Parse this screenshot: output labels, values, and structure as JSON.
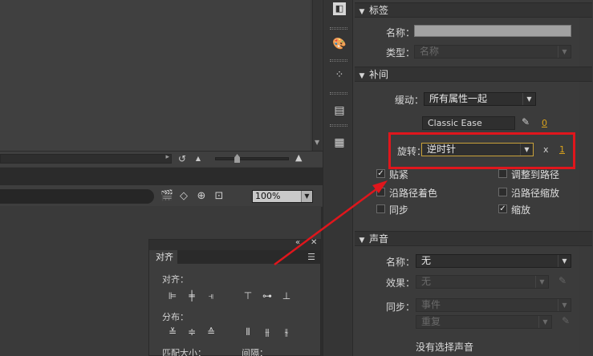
{
  "stage": {
    "timeline_icons": [
      "↺",
      "▲",
      "▲"
    ],
    "toolbar_icons": [
      "🎬",
      "◇",
      "⊕",
      "⊡"
    ],
    "zoom_value": "100%",
    "zoom_slider_level": 0.3
  },
  "align_panel": {
    "tab": "对齐",
    "align_label": "对齐：",
    "distribute_label": "分布：",
    "match_size_label": "匹配大小：",
    "spacing_label": "间隔："
  },
  "tweens_panel": {
    "label_section": {
      "title": "标签",
      "name_label": "名称：",
      "name_value": "",
      "type_label": "类型：",
      "type_value": "名称"
    },
    "tween_section": {
      "title": "补间",
      "ease_label": "缓动：",
      "ease_value": "所有属性一起",
      "ease_preset": "Classic Ease",
      "ease_number": "0",
      "rotate_label": "旋转：",
      "rotate_value": "逆时针",
      "rotate_times_x": "x",
      "rotate_times": "1",
      "checkboxes": [
        {
          "label": "贴紧",
          "checked": true
        },
        {
          "label": "调整到路径",
          "checked": false
        },
        {
          "label": "沿路径着色",
          "checked": false
        },
        {
          "label": "沿路径缩放",
          "checked": false
        },
        {
          "label": "同步",
          "checked": false
        },
        {
          "label": "缩放",
          "checked": true
        }
      ]
    },
    "sound_section": {
      "title": "声音",
      "name_label": "名称：",
      "name_value": "无",
      "effect_label": "效果：",
      "effect_value": "无",
      "sync_label": "同步：",
      "sync_value": "事件",
      "repeat_value": "重复",
      "no_sound": "没有选择声音"
    }
  },
  "colors": {
    "highlight": "#e0161c",
    "accent_number": "#d9a21b"
  }
}
